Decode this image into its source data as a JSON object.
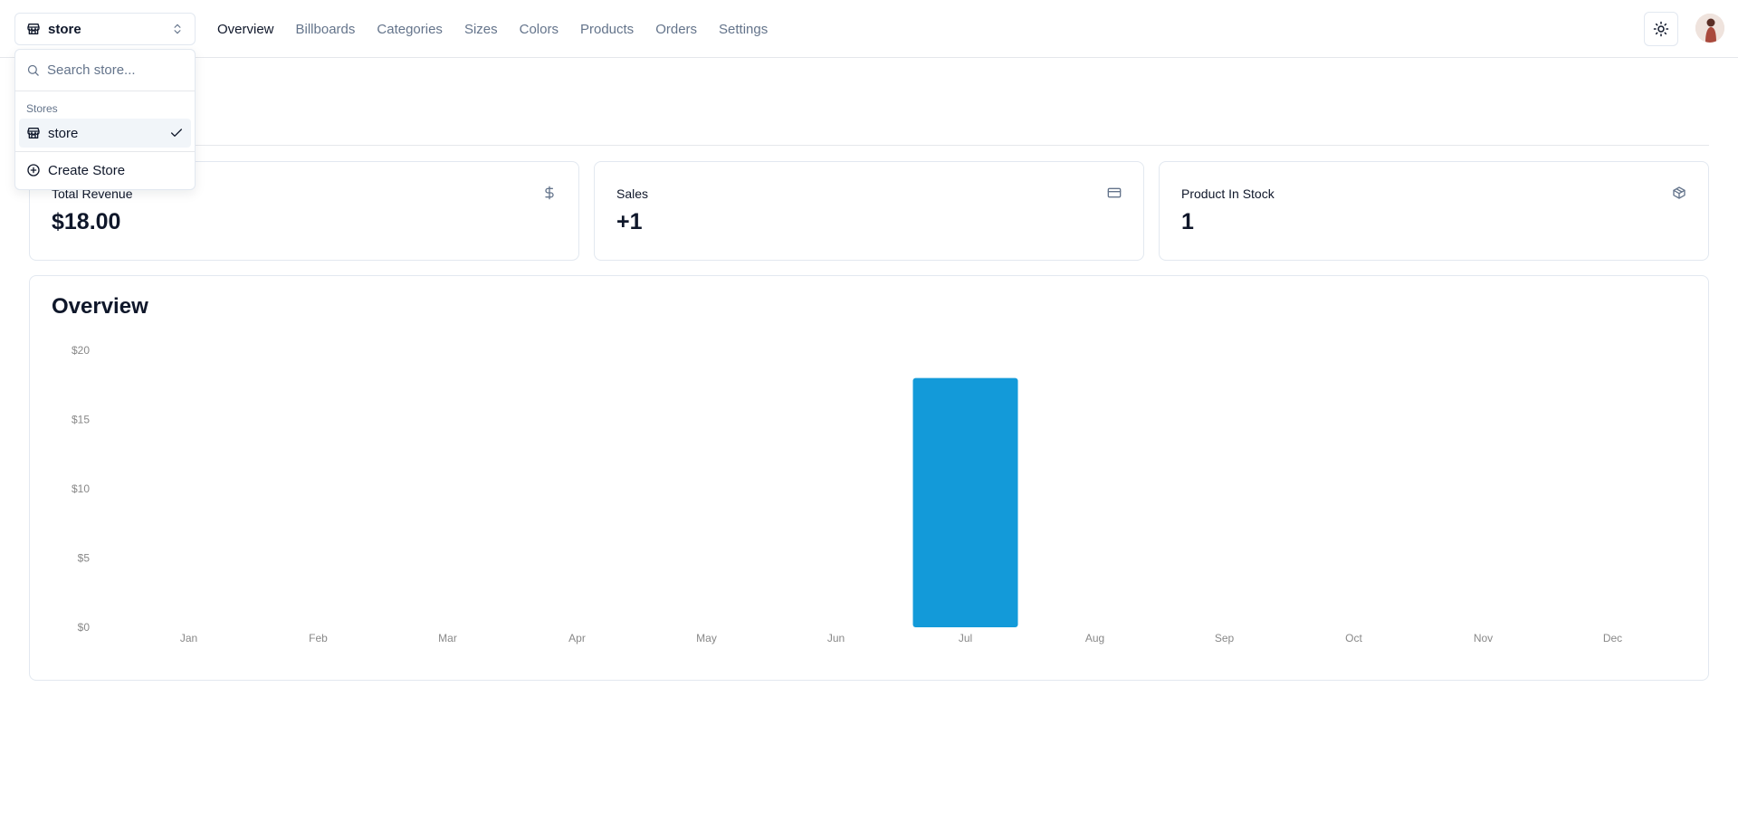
{
  "header": {
    "store_switcher": {
      "label": "store",
      "icon": "store-icon"
    },
    "nav": [
      {
        "label": "Overview",
        "active": true
      },
      {
        "label": "Billboards",
        "active": false
      },
      {
        "label": "Categories",
        "active": false
      },
      {
        "label": "Sizes",
        "active": false
      },
      {
        "label": "Colors",
        "active": false
      },
      {
        "label": "Products",
        "active": false
      },
      {
        "label": "Orders",
        "active": false
      },
      {
        "label": "Settings",
        "active": false
      }
    ],
    "theme_toggle_icon": "sun-icon"
  },
  "dropdown": {
    "search_placeholder": "Search store...",
    "group_heading": "Stores",
    "stores": [
      {
        "label": "store",
        "selected": true
      }
    ],
    "create_label": "Create Store"
  },
  "stats": [
    {
      "title": "Total Revenue",
      "value": "$18.00",
      "icon": "dollar-icon"
    },
    {
      "title": "Sales",
      "value": "+1",
      "icon": "credit-card-icon"
    },
    {
      "title": "Product In Stock",
      "value": "1",
      "icon": "package-icon"
    }
  ],
  "overview": {
    "title": "Overview"
  },
  "colors": {
    "bar": "#139ad9",
    "muted": "#64748b",
    "border": "#e2e8f0"
  },
  "chart_data": {
    "type": "bar",
    "title": "Overview",
    "categories": [
      "Jan",
      "Feb",
      "Mar",
      "Apr",
      "May",
      "Jun",
      "Jul",
      "Aug",
      "Sep",
      "Oct",
      "Nov",
      "Dec"
    ],
    "values": [
      0,
      0,
      0,
      0,
      0,
      0,
      18,
      0,
      0,
      0,
      0,
      0
    ],
    "yticks": [
      "$0",
      "$5",
      "$10",
      "$15",
      "$20"
    ],
    "ylim": [
      0,
      20
    ],
    "grid": false,
    "legend": "none",
    "xlabel": "",
    "ylabel": ""
  }
}
